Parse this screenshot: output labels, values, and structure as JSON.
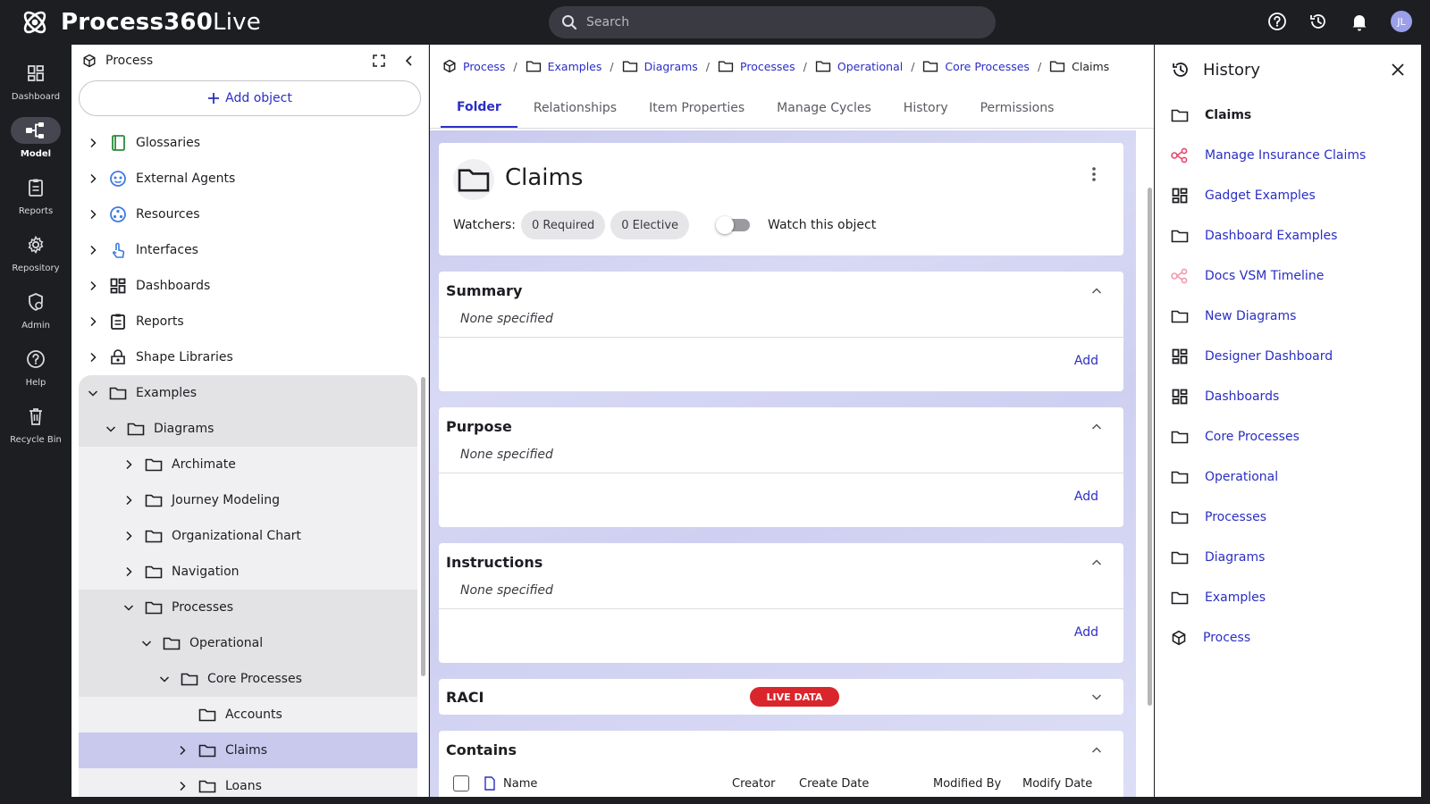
{
  "app": {
    "name_bold": "Process360",
    "name_light": "Live"
  },
  "search": {
    "placeholder": "Search"
  },
  "user": {
    "initials": "JL"
  },
  "rail": [
    {
      "label": "Dashboard",
      "icon": "dashboard-icon"
    },
    {
      "label": "Model",
      "icon": "model-icon",
      "active": true
    },
    {
      "label": "Reports",
      "icon": "reports-icon"
    },
    {
      "label": "Repository",
      "icon": "gear-icon"
    },
    {
      "label": "Admin",
      "icon": "admin-icon"
    },
    {
      "label": "Help",
      "icon": "help-icon"
    },
    {
      "label": "Recycle Bin",
      "icon": "trash-icon"
    }
  ],
  "tree_panel": {
    "title": "Process",
    "add_label": "Add object",
    "roots": [
      "Glossaries",
      "External Agents",
      "Resources",
      "Interfaces",
      "Dashboards",
      "Reports",
      "Shape Libraries"
    ],
    "nodes": {
      "examples": "Examples",
      "diagrams": "Diagrams",
      "archimate": "Archimate",
      "journey": "Journey Modeling",
      "org_chart": "Organizational Chart",
      "navigation": "Navigation",
      "processes": "Processes",
      "operational": "Operational",
      "core_processes": "Core Processes",
      "accounts": "Accounts",
      "claims": "Claims",
      "loans": "Loans"
    }
  },
  "breadcrumb": {
    "root": "Process",
    "items": [
      "Examples",
      "Diagrams",
      "Processes",
      "Operational",
      "Core Processes"
    ],
    "current": "Claims"
  },
  "tabs": [
    "Folder",
    "Relationships",
    "Item Properties",
    "Manage Cycles",
    "History",
    "Permissions"
  ],
  "folder": {
    "title": "Claims",
    "watchers_label": "Watchers:",
    "required": "0 Required",
    "elective": "0 Elective",
    "watch_label": "Watch this object"
  },
  "sections": {
    "summary": {
      "title": "Summary",
      "value": "None specified",
      "add": "Add"
    },
    "purpose": {
      "title": "Purpose",
      "value": "None specified",
      "add": "Add"
    },
    "instructions": {
      "title": "Instructions",
      "value": "None specified",
      "add": "Add"
    },
    "raci": {
      "title": "RACI",
      "badge": "LIVE DATA"
    },
    "contains": {
      "title": "Contains",
      "columns": [
        "Name",
        "Creator",
        "Create Date",
        "Modified By",
        "Modify Date"
      ]
    }
  },
  "history": {
    "title": "History",
    "items": [
      {
        "label": "Claims",
        "icon": "folder-icon"
      },
      {
        "label": "Manage Insurance Claims",
        "icon": "process-diagram-icon"
      },
      {
        "label": "Gadget Examples",
        "icon": "dashboard-icon"
      },
      {
        "label": "Dashboard Examples",
        "icon": "folder-icon"
      },
      {
        "label": "Docs VSM Timeline",
        "icon": "process-diagram-icon"
      },
      {
        "label": "New Diagrams",
        "icon": "folder-icon"
      },
      {
        "label": "Designer Dashboard",
        "icon": "dashboard-icon"
      },
      {
        "label": "Dashboards",
        "icon": "dashboard-icon"
      },
      {
        "label": "Core Processes",
        "icon": "folder-icon"
      },
      {
        "label": "Operational",
        "icon": "folder-icon"
      },
      {
        "label": "Processes",
        "icon": "folder-icon"
      },
      {
        "label": "Diagrams",
        "icon": "folder-icon"
      },
      {
        "label": "Examples",
        "icon": "folder-icon"
      },
      {
        "label": "Process",
        "icon": "cube-icon"
      }
    ]
  },
  "colors": {
    "accent": "#2b2ec4",
    "badge": "#d9262c",
    "diagram_icon": "#e8476a"
  }
}
